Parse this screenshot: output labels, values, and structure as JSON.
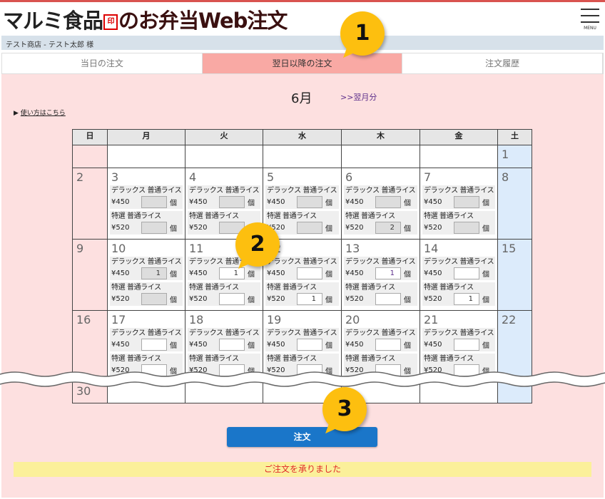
{
  "header": {
    "brand": "マルミ食品",
    "seal": "丸美",
    "suffix": "のお弁当Web注文",
    "menu_label": "MENU",
    "user": "テスト商店 - テスト太郎 様"
  },
  "tabs": [
    {
      "label": "当日の注文",
      "active": false
    },
    {
      "label": "翌日以降の注文",
      "active": true
    },
    {
      "label": "注文履歴",
      "active": false
    }
  ],
  "calendar": {
    "month": "6月",
    "next_link": ">>翌月分",
    "howto": "使い方はこちら",
    "weekdays": [
      "日",
      "月",
      "火",
      "水",
      "木",
      "金",
      "土"
    ],
    "unit": "個",
    "items": [
      {
        "label": "デラックス 普通ライス",
        "price": "¥450"
      },
      {
        "label": "特選 普通ライス",
        "price": "¥520"
      }
    ],
    "weeks": [
      [
        {
          "day": ""
        },
        {
          "day": ""
        },
        {
          "day": ""
        },
        {
          "day": ""
        },
        {
          "day": ""
        },
        {
          "day": ""
        },
        {
          "day": "1"
        }
      ],
      [
        {
          "day": "2"
        },
        {
          "day": "3",
          "disabled": true,
          "qty": [
            "",
            ""
          ]
        },
        {
          "day": "4",
          "disabled": true,
          "qty": [
            "",
            ""
          ]
        },
        {
          "day": "5",
          "disabled": true,
          "qty": [
            "",
            ""
          ]
        },
        {
          "day": "6",
          "disabled": true,
          "qty": [
            "",
            "2"
          ]
        },
        {
          "day": "7",
          "disabled": true,
          "qty": [
            "",
            ""
          ]
        },
        {
          "day": "8"
        }
      ],
      [
        {
          "day": "9"
        },
        {
          "day": "10",
          "disabled": true,
          "qty": [
            "1",
            ""
          ]
        },
        {
          "day": "11",
          "qty": [
            "1",
            ""
          ]
        },
        {
          "day": "12",
          "qty": [
            "",
            "1"
          ]
        },
        {
          "day": "13",
          "qty": [
            "1",
            ""
          ]
        },
        {
          "day": "14",
          "qty": [
            "",
            "1"
          ]
        },
        {
          "day": "15"
        }
      ],
      [
        {
          "day": "16"
        },
        {
          "day": "17",
          "qty": [
            "",
            ""
          ]
        },
        {
          "day": "18",
          "qty": [
            "",
            ""
          ]
        },
        {
          "day": "19",
          "qty": [
            "",
            ""
          ]
        },
        {
          "day": "20",
          "qty": [
            "",
            ""
          ]
        },
        {
          "day": "21",
          "qty": [
            "",
            ""
          ]
        },
        {
          "day": "22"
        }
      ],
      [
        {
          "day": "30"
        },
        {
          "day": ""
        },
        {
          "day": ""
        },
        {
          "day": ""
        },
        {
          "day": ""
        },
        {
          "day": ""
        },
        {
          "day": ""
        }
      ]
    ]
  },
  "order_button": "注文",
  "message": "ご注文を承りました",
  "callouts": [
    "1",
    "2",
    "3"
  ],
  "colors": {
    "accent_tab": "#f9a9a4",
    "button": "#1a76c9",
    "message_bg": "#fbf09a",
    "message_text": "#e02a2a",
    "callout": "#fdbf0f"
  }
}
